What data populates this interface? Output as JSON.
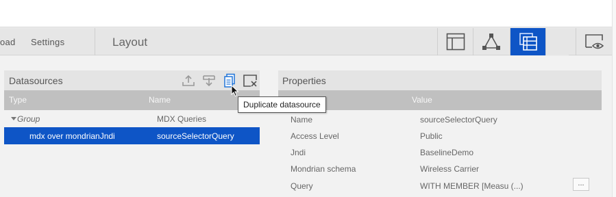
{
  "menubar": {
    "items": [
      {
        "label": "oad"
      },
      {
        "label": "Settings"
      }
    ],
    "layout_title": "Layout",
    "view_buttons": [
      {
        "icon": "layout-panels-icon",
        "active": false
      },
      {
        "icon": "network-diagram-icon",
        "active": false
      },
      {
        "icon": "datasources-icon",
        "active": true
      },
      {
        "icon": "preview-eye-icon",
        "active": false
      }
    ]
  },
  "datasources": {
    "title": "Datasources",
    "toolbar_icons": [
      "export-icon",
      "import-icon",
      "duplicate-icon",
      "delete-icon"
    ],
    "columns": {
      "type": "Type",
      "name": "Name"
    },
    "group": {
      "type": "Group",
      "name": "MDX Queries"
    },
    "selected_row": {
      "type": "mdx over mondrianJndi",
      "name": "sourceSelectorQuery"
    }
  },
  "tooltip": {
    "text": "Duplicate datasource"
  },
  "properties": {
    "title": "Properties",
    "columns": {
      "value": "Value"
    },
    "rows": [
      {
        "name": "Name",
        "value": "sourceSelectorQuery"
      },
      {
        "name": "Access Level",
        "value": "Public"
      },
      {
        "name": "Jndi",
        "value": "BaselineDemo"
      },
      {
        "name": "Mondrian schema",
        "value": "Wireless Carrier"
      },
      {
        "name": "Query",
        "value": "WITH MEMBER [Measu (...)",
        "button": "..."
      }
    ]
  },
  "colors": {
    "accent": "#0e55c6",
    "header_grey": "#c0c0c0"
  }
}
